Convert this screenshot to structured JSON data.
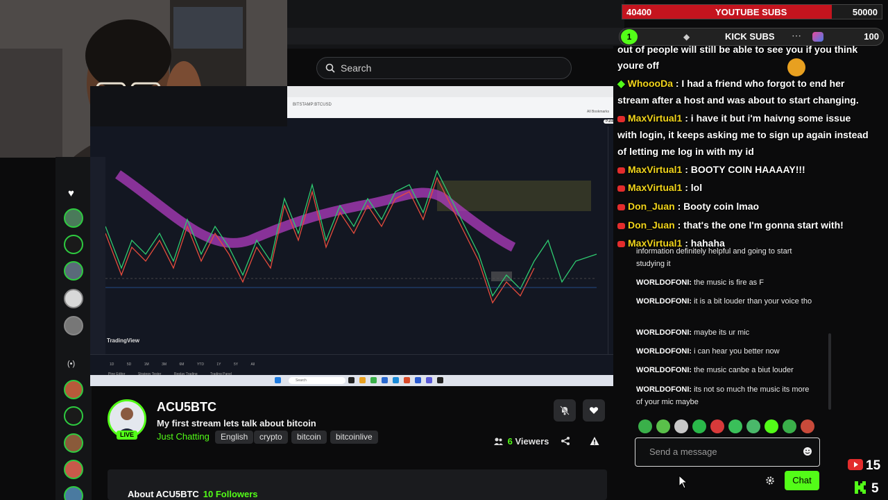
{
  "search": {
    "placeholder": "Search"
  },
  "browser": {
    "url": "BITSTAMP:BTCUSD",
    "bookmarks": "All Bookmarks",
    "publish": "Publish"
  },
  "tradingview": {
    "logo": "TradingView",
    "bottom_tabs": [
      "Pine Editor",
      "Strategy Tester",
      "Replay Trading",
      "Trading Panel"
    ],
    "timeframes": [
      "1D",
      "5D",
      "1M",
      "3M",
      "6M",
      "YTD",
      "1Y",
      "5Y",
      "All"
    ]
  },
  "taskbar": {
    "search_placeholder": "Search"
  },
  "channel": {
    "name": "ACU5BTC",
    "live_label": "LIVE",
    "title": "My first stream lets talk about bitcoin",
    "category": "Just Chatting",
    "tags": [
      "English",
      "crypto",
      "bitcoin",
      "bitcoinlive"
    ],
    "viewers_count": "6",
    "viewers_label": "Viewers",
    "about_label": "About ACU5BTC",
    "followers": "10 Followers"
  },
  "overlays": {
    "youtube_goal": {
      "current": "40400",
      "label": "YOUTUBE SUBS",
      "target": "50000",
      "progress": 0.808
    },
    "kick_goal": {
      "badge": "1",
      "label": "KICK SUBS",
      "target": "100"
    },
    "youtube_viewers": "15",
    "kick_viewers": "5",
    "accent_youtube": "#c4141e",
    "accent_kick": "#53fc18"
  },
  "chat_big": [
    {
      "user": "",
      "text": "out of people will still be able to see you if you think"
    },
    {
      "user": "",
      "text": "youre off"
    },
    {
      "user": "WhoooDa",
      "text": " : I had a friend who forgot to end her"
    },
    {
      "user": "",
      "text": "stream after a host and was about to start changing."
    },
    {
      "user": "MaxVirtual1",
      "text": " : i have it but i'm haivng some issue"
    },
    {
      "user": "",
      "text": "with login, it keeps asking me to sign up again instead"
    },
    {
      "user": "",
      "text": "of letting me log in with my id"
    },
    {
      "user": "MaxVirtual1",
      "text": " : BOOTY COIN HAAAAY!!!"
    },
    {
      "user": "MaxVirtual1",
      "text": " : lol"
    },
    {
      "user": "Don_Juan",
      "text": " : Booty coin lmao"
    },
    {
      "user": "Don_Juan",
      "text": " : that's the one I'm gonna start with!"
    },
    {
      "user": "MaxVirtual1",
      "text": " : hahaha"
    }
  ],
  "chat_small": [
    {
      "user": "",
      "text": "information definitely helpful and going to start studying it"
    },
    {
      "user": "WORLDOFONI:",
      "text": " the music is fire as F"
    },
    {
      "user": "WORLDOFONI:",
      "text": " it is a bit louder than your voice tho"
    },
    {
      "user": "WORLDOFONI:",
      "text": " maybe its ur mic"
    },
    {
      "user": "WORLDOFONI:",
      "text": " i can hear you better now"
    },
    {
      "user": "WORLDOFONI:",
      "text": " the music canbe a biut louder"
    },
    {
      "user": "WORLDOFONI:",
      "text": " its not so much the music its more of your mic maybe"
    }
  ],
  "chat_input": {
    "placeholder": "Send a message",
    "send_label": "Chat"
  }
}
